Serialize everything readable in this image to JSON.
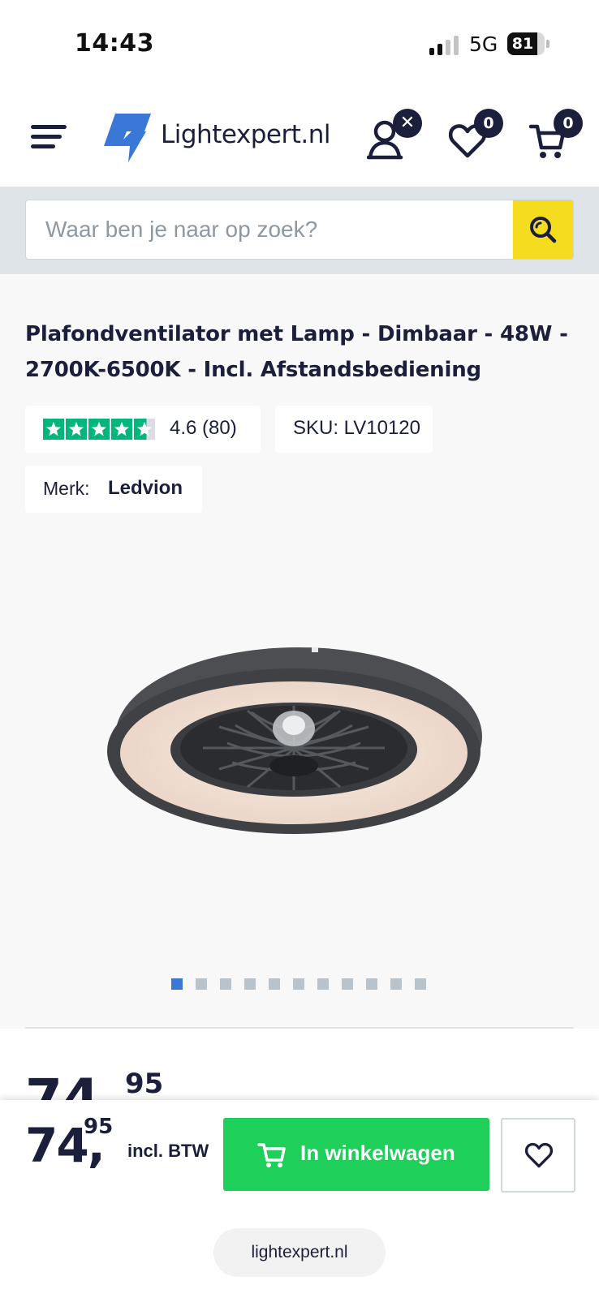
{
  "status_bar": {
    "time": "14:43",
    "network": "5G",
    "battery": "81",
    "battery_level": 0.81
  },
  "header": {
    "logo_text": "Lightexpert.nl",
    "account_badge": "✕",
    "wishlist_count": "0",
    "cart_count": "0",
    "icons": [
      "menu-icon",
      "logo-bolt-icon",
      "account-icon",
      "heart-icon",
      "cart-icon"
    ]
  },
  "search": {
    "placeholder": "Waar ben je naar op zoek?"
  },
  "product": {
    "title": "Plafondventilator met Lamp - Dimbaar - 48W - 2700K-6500K - Incl. Afstandsbediening",
    "rating": "4.6 (80)",
    "rating_stars": 4.6,
    "sku": "SKU: LV10120",
    "brand_label": "Merk:",
    "brand_value": "Ledvion",
    "image_count": 11,
    "active_image": 1
  },
  "price": {
    "integer": "74,",
    "decimals": "95",
    "vat_label": "incl. BTW"
  },
  "actions": {
    "add_to_cart_label": "In winkelwagen"
  },
  "browser": {
    "url": "lightexpert.nl"
  },
  "colors": {
    "brand_navy": "#1b1f3b",
    "brand_blue": "#3a78d8",
    "search_yellow": "#f5dc1f",
    "cart_green": "#1ed05a",
    "trustpilot_green": "#00b67a"
  }
}
